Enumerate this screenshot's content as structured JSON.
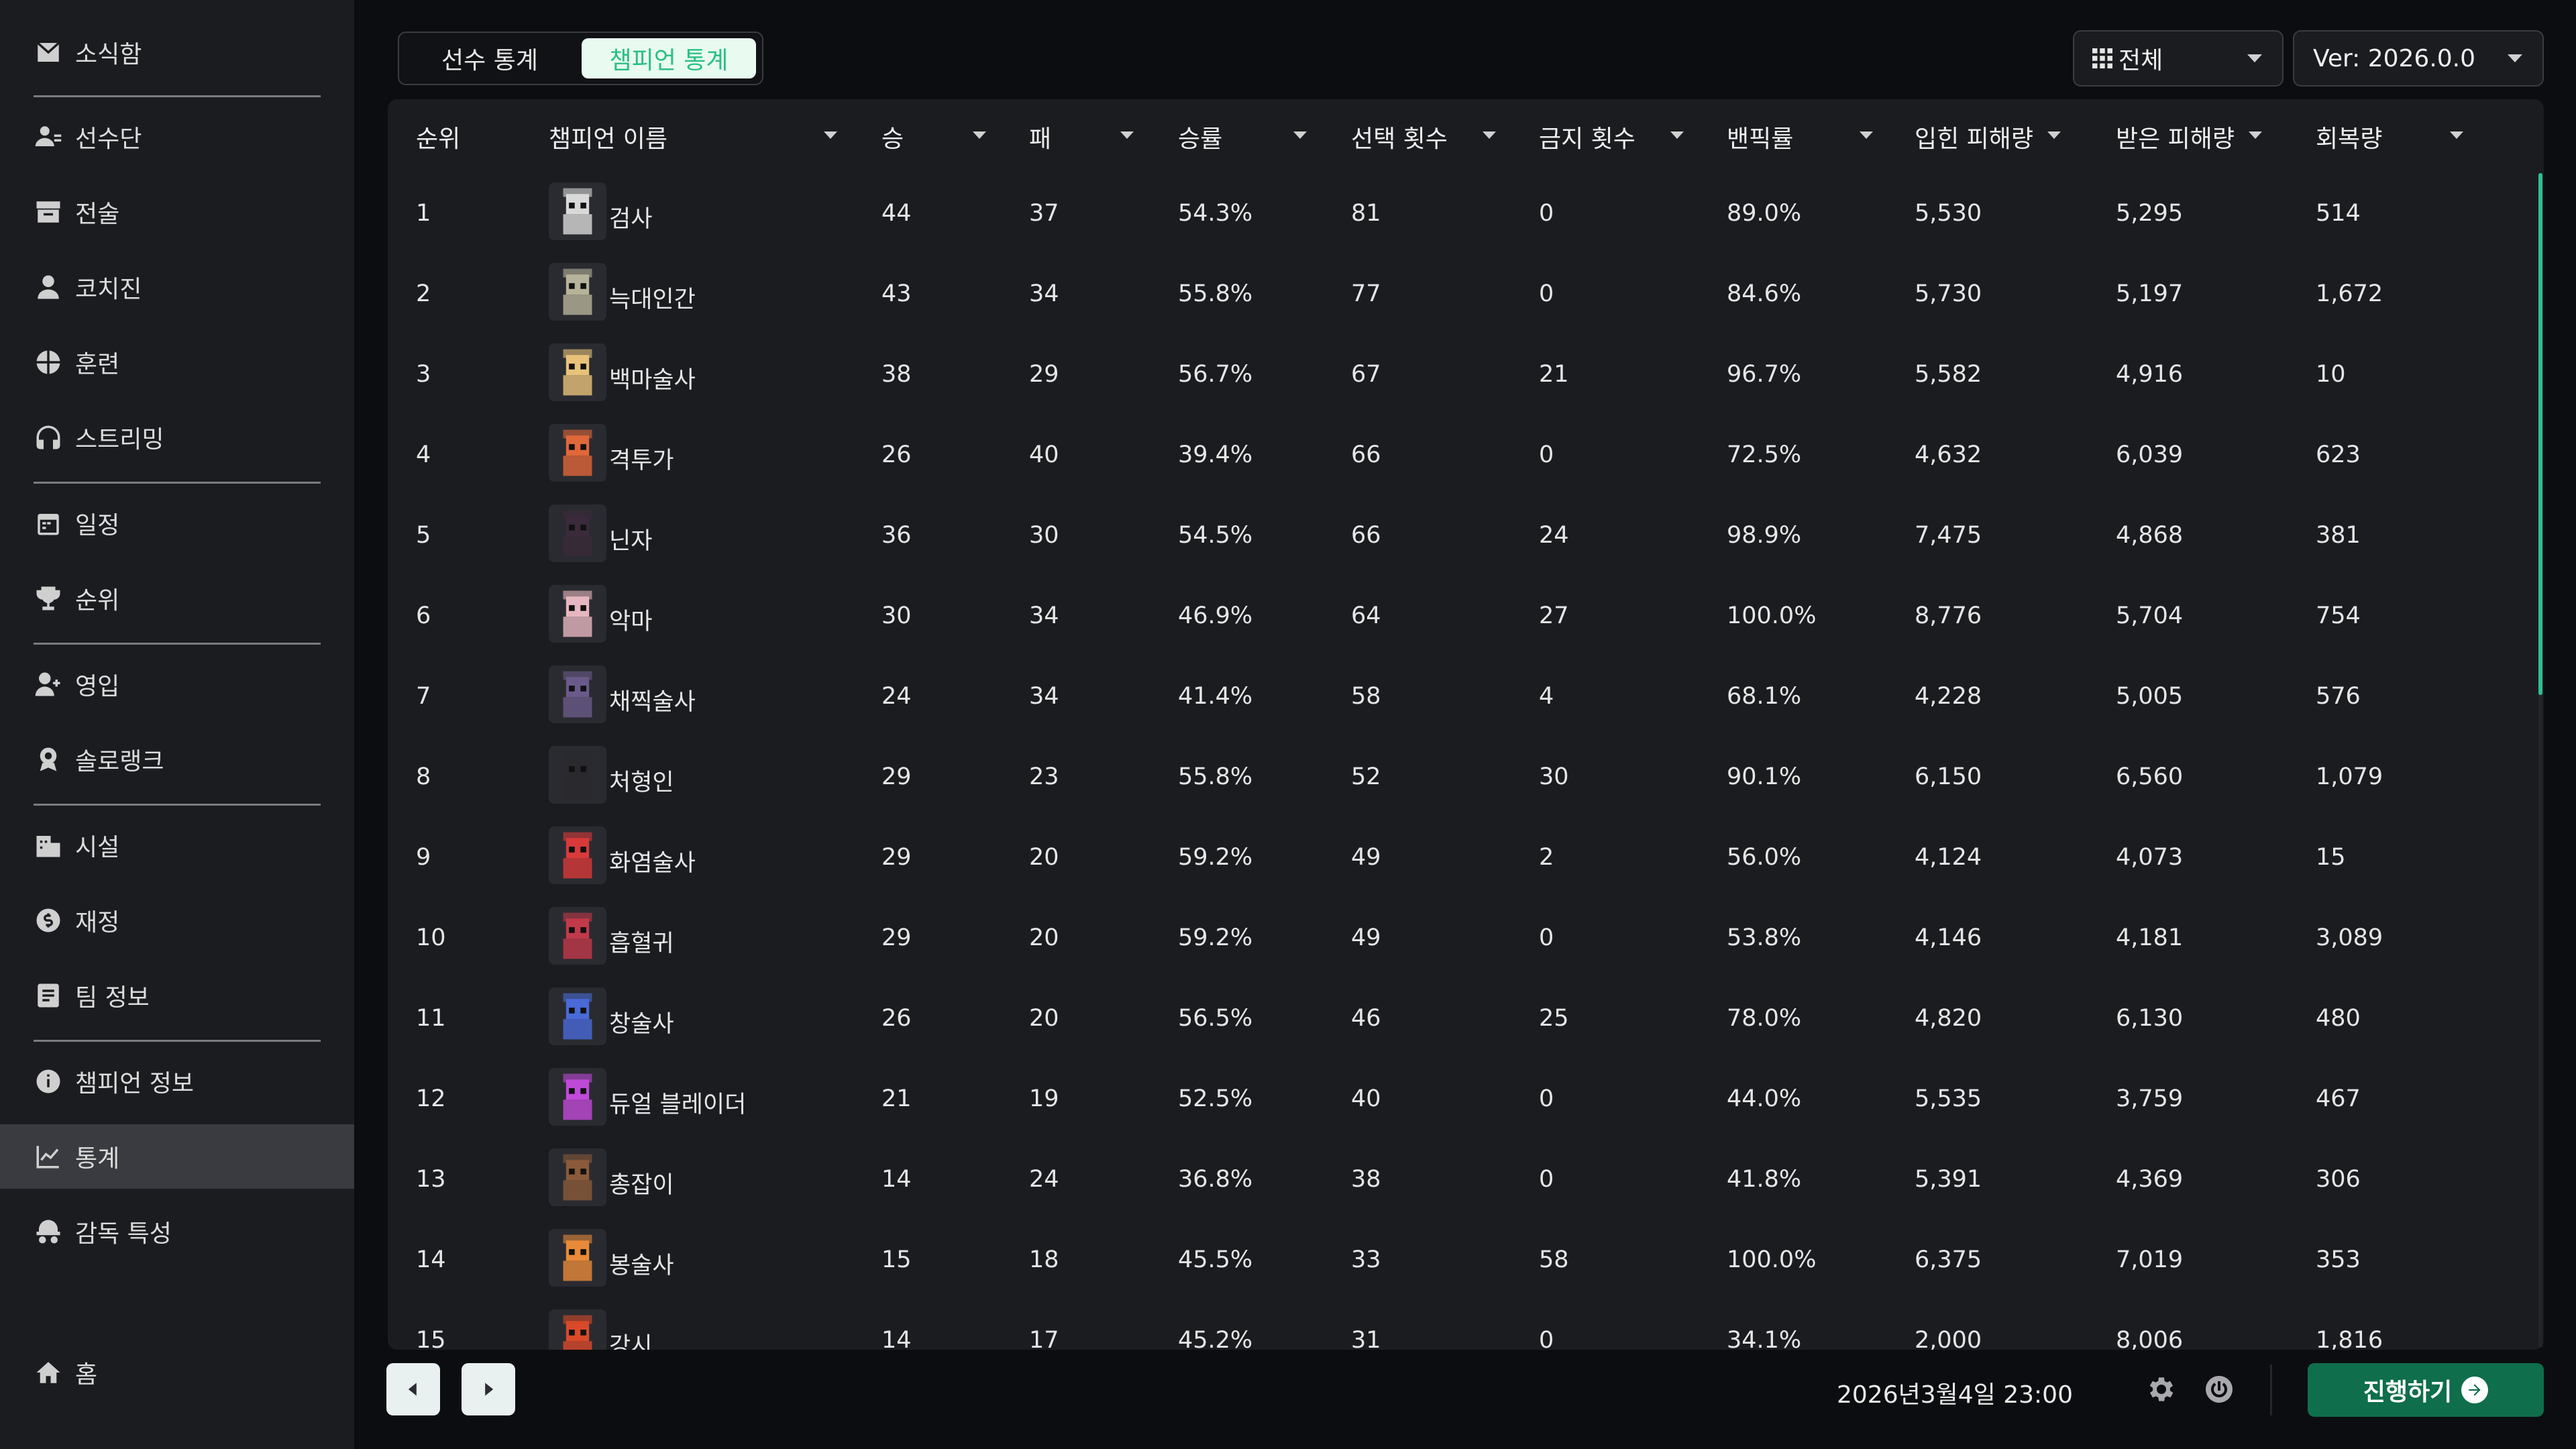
{
  "sidebar": {
    "items": [
      {
        "label": "소식함",
        "icon": "mail-icon"
      },
      {
        "label": "선수단",
        "icon": "team-icon"
      },
      {
        "label": "전술",
        "icon": "tactics-icon"
      },
      {
        "label": "코치진",
        "icon": "coach-icon"
      },
      {
        "label": "훈련",
        "icon": "training-icon"
      },
      {
        "label": "스트리밍",
        "icon": "headset-icon"
      },
      {
        "label": "일정",
        "icon": "calendar-icon"
      },
      {
        "label": "순위",
        "icon": "trophy-icon"
      },
      {
        "label": "영입",
        "icon": "add-person-icon"
      },
      {
        "label": "솔로랭크",
        "icon": "medal-icon"
      },
      {
        "label": "시설",
        "icon": "building-icon"
      },
      {
        "label": "재정",
        "icon": "money-icon"
      },
      {
        "label": "팀 정보",
        "icon": "team-info-icon"
      },
      {
        "label": "챔피언 정보",
        "icon": "info-icon"
      },
      {
        "label": "통계",
        "icon": "chart-icon",
        "active": true
      },
      {
        "label": "감독 특성",
        "icon": "manager-icon"
      }
    ],
    "home": {
      "label": "홈",
      "icon": "home-icon"
    }
  },
  "tabs": {
    "player": "선수 통계",
    "champion": "챔피언 통계",
    "active": "champion"
  },
  "filter": {
    "label": "전체",
    "icon": "grid-icon"
  },
  "version": {
    "label": "Ver: 2026.0.0"
  },
  "table": {
    "headers": [
      "순위",
      "챔피언 이름",
      "승",
      "패",
      "승률",
      "선택 횟수",
      "금지 횟수",
      "밴픽률",
      "입힌 피해량",
      "받은 피해량",
      "회복량"
    ],
    "rows": [
      {
        "rank": "1",
        "name": "검사",
        "wins": "44",
        "losses": "37",
        "winrate": "54.3%",
        "picks": "81",
        "bans": "0",
        "banpick": "89.0%",
        "dealt": "5,530",
        "taken": "5,295",
        "heal": "514",
        "color": "#d9d9d9"
      },
      {
        "rank": "2",
        "name": "늑대인간",
        "wins": "43",
        "losses": "34",
        "winrate": "55.8%",
        "picks": "77",
        "bans": "0",
        "banpick": "84.6%",
        "dealt": "5,730",
        "taken": "5,197",
        "heal": "1,672",
        "color": "#b7b39a"
      },
      {
        "rank": "3",
        "name": "백마술사",
        "wins": "38",
        "losses": "29",
        "winrate": "56.7%",
        "picks": "67",
        "bans": "21",
        "banpick": "96.7%",
        "dealt": "5,582",
        "taken": "4,916",
        "heal": "10",
        "color": "#e8c27a"
      },
      {
        "rank": "4",
        "name": "격투가",
        "wins": "26",
        "losses": "40",
        "winrate": "39.4%",
        "picks": "66",
        "bans": "0",
        "banpick": "72.5%",
        "dealt": "4,632",
        "taken": "6,039",
        "heal": "623",
        "color": "#e0673a"
      },
      {
        "rank": "5",
        "name": "닌자",
        "wins": "36",
        "losses": "30",
        "winrate": "54.5%",
        "picks": "66",
        "bans": "24",
        "banpick": "98.9%",
        "dealt": "7,475",
        "taken": "4,868",
        "heal": "381",
        "color": "#3a2a3a"
      },
      {
        "rank": "6",
        "name": "악마",
        "wins": "30",
        "losses": "34",
        "winrate": "46.9%",
        "picks": "64",
        "bans": "27",
        "banpick": "100.0%",
        "dealt": "8,776",
        "taken": "5,704",
        "heal": "754",
        "color": "#e6b7c0"
      },
      {
        "rank": "7",
        "name": "채찍술사",
        "wins": "24",
        "losses": "34",
        "winrate": "41.4%",
        "picks": "58",
        "bans": "4",
        "banpick": "68.1%",
        "dealt": "4,228",
        "taken": "5,005",
        "heal": "576",
        "color": "#6a5a8a"
      },
      {
        "rank": "8",
        "name": "처형인",
        "wins": "29",
        "losses": "23",
        "winrate": "55.8%",
        "picks": "52",
        "bans": "30",
        "banpick": "90.1%",
        "dealt": "6,150",
        "taken": "6,560",
        "heal": "1,079",
        "color": "#2a2a2e"
      },
      {
        "rank": "9",
        "name": "화염술사",
        "wins": "29",
        "losses": "20",
        "winrate": "59.2%",
        "picks": "49",
        "bans": "2",
        "banpick": "56.0%",
        "dealt": "4,124",
        "taken": "4,073",
        "heal": "15",
        "color": "#d83a3a"
      },
      {
        "rank": "10",
        "name": "흡혈귀",
        "wins": "29",
        "losses": "20",
        "winrate": "59.2%",
        "picks": "49",
        "bans": "0",
        "banpick": "53.8%",
        "dealt": "4,146",
        "taken": "4,181",
        "heal": "3,089",
        "color": "#c23a4a"
      },
      {
        "rank": "11",
        "name": "창술사",
        "wins": "26",
        "losses": "20",
        "winrate": "56.5%",
        "picks": "46",
        "bans": "25",
        "banpick": "78.0%",
        "dealt": "4,820",
        "taken": "6,130",
        "heal": "480",
        "color": "#4a6ad8"
      },
      {
        "rank": "12",
        "name": "듀얼 블레이더",
        "wins": "21",
        "losses": "19",
        "winrate": "52.5%",
        "picks": "40",
        "bans": "0",
        "banpick": "44.0%",
        "dealt": "5,535",
        "taken": "3,759",
        "heal": "467",
        "color": "#c04ad8"
      },
      {
        "rank": "13",
        "name": "총잡이",
        "wins": "14",
        "losses": "24",
        "winrate": "36.8%",
        "picks": "38",
        "bans": "0",
        "banpick": "41.8%",
        "dealt": "5,391",
        "taken": "4,369",
        "heal": "306",
        "color": "#8a5a3a"
      },
      {
        "rank": "14",
        "name": "봉술사",
        "wins": "15",
        "losses": "18",
        "winrate": "45.5%",
        "picks": "33",
        "bans": "58",
        "banpick": "100.0%",
        "dealt": "6,375",
        "taken": "7,019",
        "heal": "353",
        "color": "#e88a3a"
      },
      {
        "rank": "15",
        "name": "강시",
        "wins": "14",
        "losses": "17",
        "winrate": "45.2%",
        "picks": "31",
        "bans": "0",
        "banpick": "34.1%",
        "dealt": "2,000",
        "taken": "8,006",
        "heal": "1,816",
        "color": "#d84a2a"
      }
    ]
  },
  "footer": {
    "datetime": "2026년3월4일 23:00",
    "proceed_label": "진행하기"
  },
  "colors": {
    "accent": "#2bbf84",
    "proceed_bg": "#0f6e4c",
    "sidebar_bg": "#1b1c20",
    "panel_bg": "#1b1c20"
  }
}
